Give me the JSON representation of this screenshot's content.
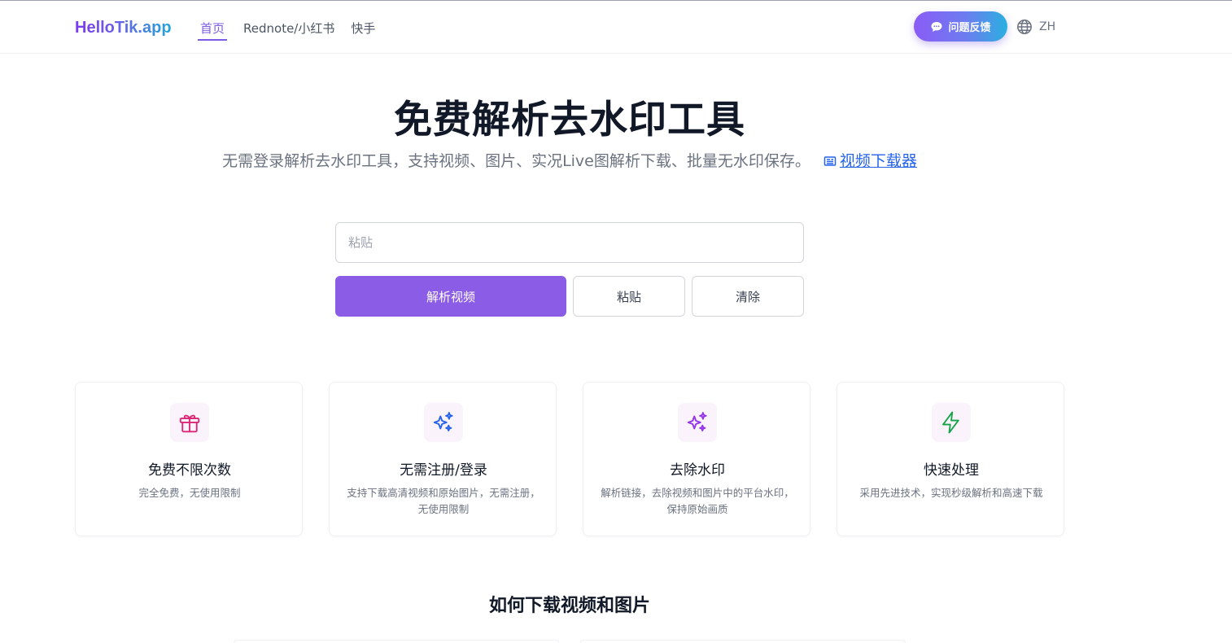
{
  "header": {
    "logo": "HelloTik.app",
    "nav": [
      {
        "label": "首页",
        "active": true
      },
      {
        "label": "Rednote/小红书",
        "active": false
      },
      {
        "label": "快手",
        "active": false
      }
    ],
    "feedback_label": "问题反馈",
    "language": "ZH"
  },
  "hero": {
    "title": "免费解析去水印工具",
    "subtitle": "无需登录解析去水印工具，支持视频、图片、实况Live图解析下载、批量无水印保存。",
    "downloader_link": "视频下载器"
  },
  "form": {
    "input_placeholder": "粘贴",
    "input_value": "",
    "parse_label": "解析视频",
    "paste_label": "粘贴",
    "clear_label": "清除"
  },
  "features": [
    {
      "icon": "gift-icon",
      "icon_color": "#db2777",
      "title": "免费不限次数",
      "desc": "完全免费，无使用限制"
    },
    {
      "icon": "sparkles-icon",
      "icon_color": "#2563eb",
      "title": "无需注册/登录",
      "desc": "支持下载高清视频和原始图片，无需注册，无使用限制"
    },
    {
      "icon": "sparkles-icon",
      "icon_color": "#9333ea",
      "title": "去除水印",
      "desc": "解析链接，去除视频和图片中的平台水印，保持原始画质"
    },
    {
      "icon": "lightning-icon",
      "icon_color": "#16a34a",
      "title": "快速处理",
      "desc": "采用先进技术，实现秒级解析和高速下载"
    }
  ],
  "howto": {
    "title": "如何下载视频和图片"
  },
  "colors": {
    "brand": "#8b5ce6",
    "link": "#2563eb"
  }
}
